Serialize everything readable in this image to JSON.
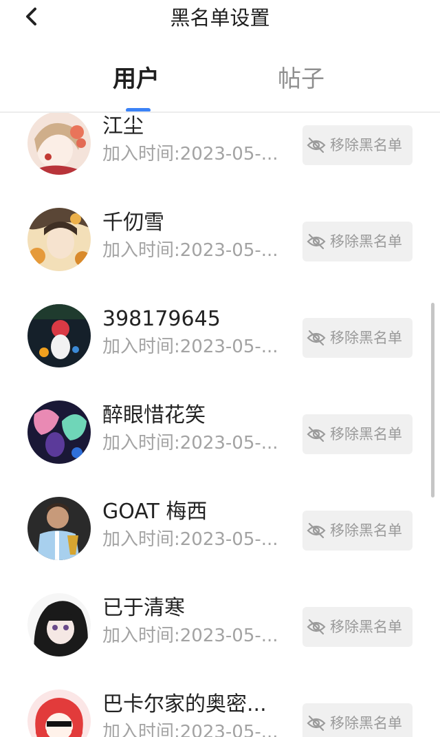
{
  "header": {
    "title": "黑名单设置",
    "back_icon": "chevron-left-icon"
  },
  "tabs": [
    {
      "label": "用户",
      "active": true
    },
    {
      "label": "帖子",
      "active": false
    }
  ],
  "colors": {
    "accent": "#3b82f6",
    "title_text": "#1f1f1f",
    "secondary_text": "#a3a3a3",
    "button_bg": "#f0f0f0",
    "button_text": "#9a9a9a"
  },
  "blacklist": {
    "remove_label": "移除黑名单",
    "remove_icon": "eye-off-icon",
    "users": [
      {
        "name": "江尘",
        "time": "加入时间:2023-05-..."
      },
      {
        "name": "千仞雪",
        "time": "加入时间:2023-05-..."
      },
      {
        "name": "398179645",
        "time": "加入时间:2023-05-..."
      },
      {
        "name": "醉眼惜花笑",
        "time": "加入时间:2023-05-..."
      },
      {
        "name": "GOAT 梅西",
        "time": "加入时间:2023-05-..."
      },
      {
        "name": "已于清寒",
        "time": "加入时间:2023-05-..."
      },
      {
        "name": "巴卡尔家的奥密...",
        "time": "加入时间:2023-05-..."
      }
    ]
  }
}
